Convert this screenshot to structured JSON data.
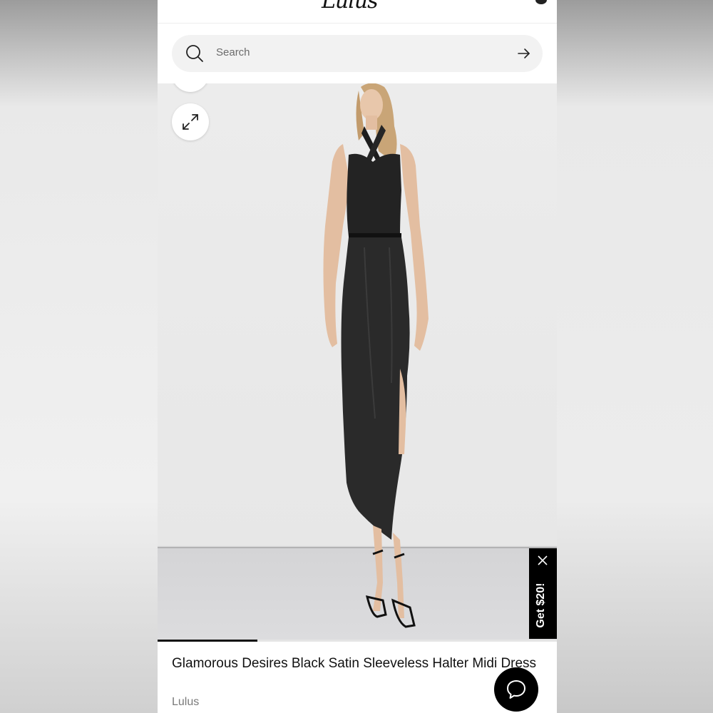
{
  "header": {
    "logo_text": "Lulus"
  },
  "search": {
    "placeholder": "Search",
    "icon": "search-icon",
    "submit_icon": "arrow-right-icon"
  },
  "gallery": {
    "expand_icon": "expand-icon",
    "progress_fraction": 0.25
  },
  "promo": {
    "label": "Get $20!",
    "close_icon": "close-icon"
  },
  "product": {
    "title": "Glamorous Desires Black Satin Sleeveless Halter Midi Dress",
    "brand": "Lulus"
  },
  "chat": {
    "icon": "chat-bubble-icon"
  }
}
